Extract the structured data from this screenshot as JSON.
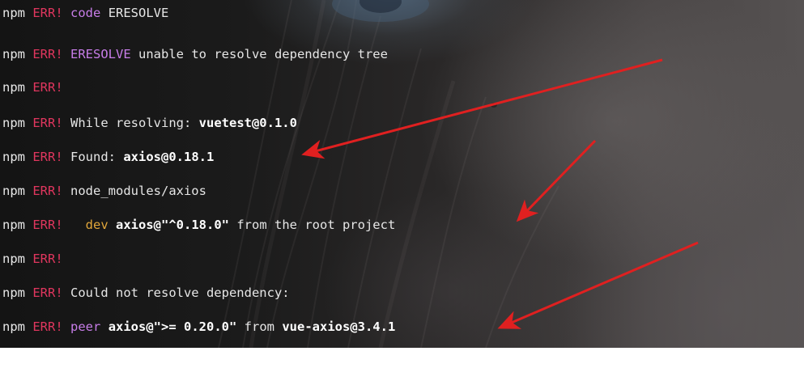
{
  "terminal": {
    "lines": [
      {
        "npm": "npm",
        "err": "ERR!",
        "code_label": "code",
        "code_value": "ERESOLVE"
      },
      {
        "npm": "npm",
        "err": "ERR!",
        "keyword": "ERESOLVE",
        "text": " unable to resolve dependency tree"
      },
      {
        "npm": "npm",
        "err": "ERR!"
      },
      {
        "npm": "npm",
        "err": "ERR!",
        "text": " While resolving: ",
        "bold": "vuetest@0.1.0"
      },
      {
        "npm": "npm",
        "err": "ERR!",
        "text": " Found: ",
        "bold": "axios@0.18.1"
      },
      {
        "npm": "npm",
        "err": "ERR!",
        "text": " node_modules/axios"
      },
      {
        "npm": "npm",
        "err": "ERR!",
        "dev": "dev",
        "bold": "axios@\"^0.18.0\"",
        "text": " from the root project"
      },
      {
        "npm": "npm",
        "err": "ERR!"
      },
      {
        "npm": "npm",
        "err": "ERR!",
        "text": " Could not resolve dependency:"
      },
      {
        "npm": "npm",
        "err": "ERR!",
        "keyword": "peer",
        "bold": "axios@\">= 0.20.0\"",
        "text": " from ",
        "bold2": "vue-axios@3.4.1"
      }
    ]
  },
  "annotations": {
    "arrow_color": "#e02020",
    "arrows": [
      "arrow-to-found-version",
      "arrow-to-root-requirement",
      "arrow-to-peer-requirement"
    ]
  },
  "colors": {
    "err": "#e0365e",
    "keyword": "#c77de8",
    "dev": "#e0a63a",
    "text": "#e6e6e6"
  }
}
